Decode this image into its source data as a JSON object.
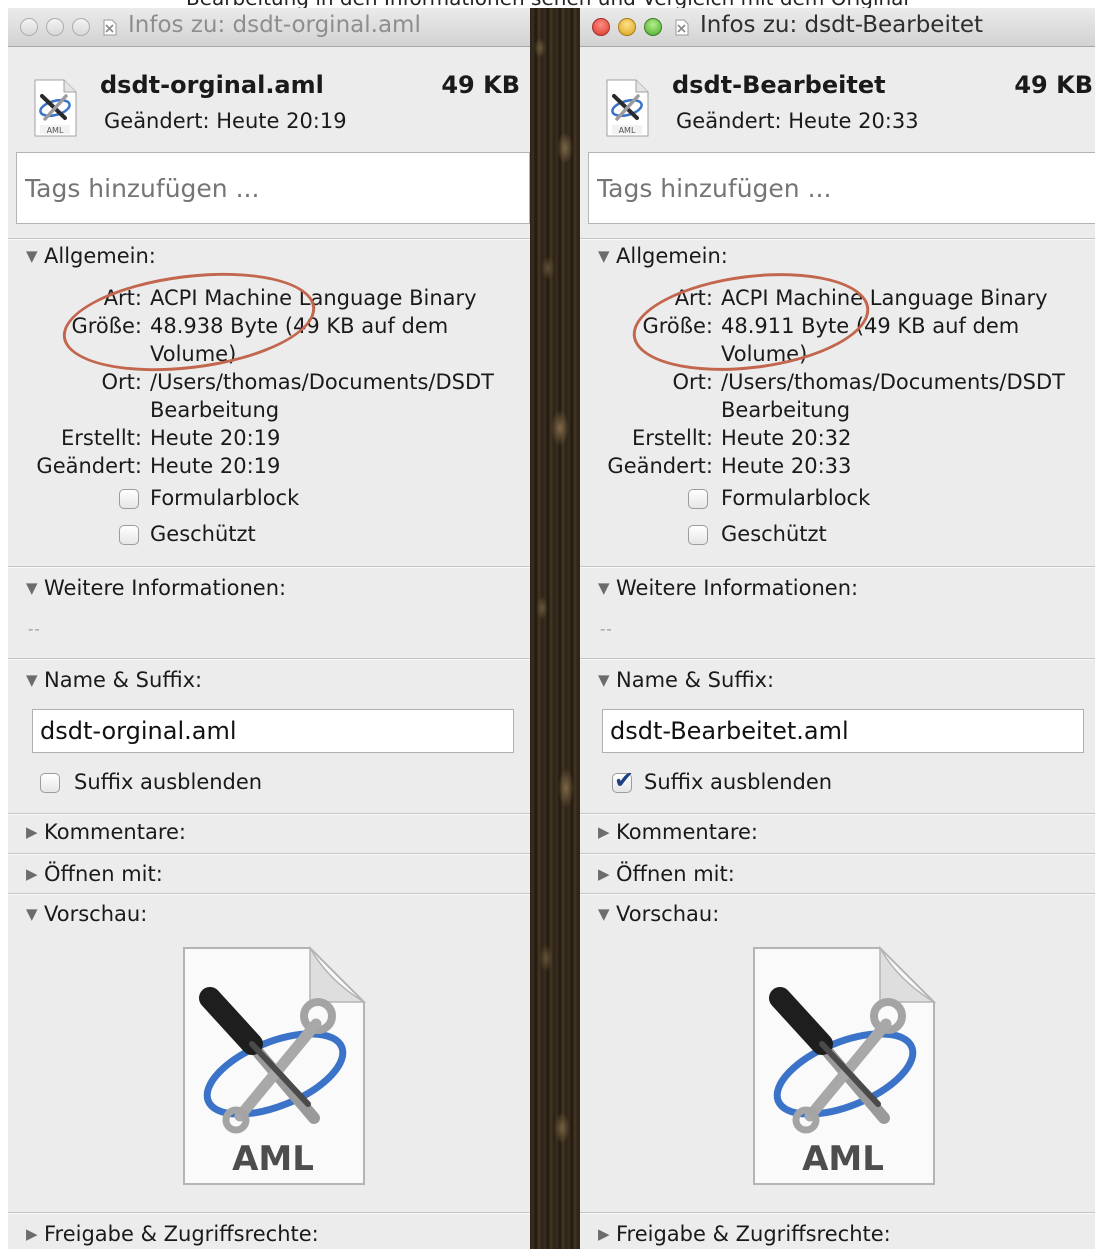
{
  "caption": "Bearbeitung in den Informationen sehen und Vergleich mit dem Original",
  "windows": [
    {
      "window_title": "Infos zu: dsdt-orginal.aml",
      "active": false,
      "file_name": "dsdt-orginal.aml",
      "file_size": "49 KB",
      "modified_line": "Geändert: Heute 20:19",
      "tags_placeholder": "Tags hinzufügen ...",
      "general": {
        "header": "Allgemein:",
        "art_label": "Art:",
        "art_value": "ACPI Machine Language Binary",
        "size_label": "Größe:",
        "size_value_line1": "48.938 Byte (49 KB auf dem",
        "size_value_line2": "Volume)",
        "location_label": "Ort:",
        "location_line1": "/Users/thomas/Documents/DSDT",
        "location_line2": "Bearbeitung",
        "created_label": "Erstellt:",
        "created_value": "Heute 20:19",
        "modified_label": "Geändert:",
        "modified_value": "Heute 20:19",
        "stationery_label": "Formularblock",
        "stationery_checked": false,
        "locked_label": "Geschützt",
        "locked_checked": false
      },
      "more_info": {
        "header": "Weitere Informationen:",
        "value": "--"
      },
      "name_extension": {
        "header": "Name & Suffix:",
        "field_value": "dsdt-orginal.aml",
        "hide_extension_label": "Suffix ausblenden",
        "hide_extension_checked": false
      },
      "comments_header": "Kommentare:",
      "open_with_header": "Öffnen mit:",
      "preview_header": "Vorschau:",
      "preview_icon_text": "AML",
      "sharing_header": "Freigabe & Zugriffsrechte:"
    },
    {
      "window_title": "Infos zu: dsdt-Bearbeitet",
      "active": true,
      "file_name": "dsdt-Bearbeitet",
      "file_size": "49 KB",
      "modified_line": "Geändert: Heute 20:33",
      "tags_placeholder": "Tags hinzufügen ...",
      "general": {
        "header": "Allgemein:",
        "art_label": "Art:",
        "art_value": "ACPI Machine Language Binary",
        "size_label": "Größe:",
        "size_value_line1": "48.911 Byte (49 KB auf dem",
        "size_value_line2": "Volume)",
        "location_label": "Ort:",
        "location_line1": "/Users/thomas/Documents/DSDT",
        "location_line2": "Bearbeitung",
        "created_label": "Erstellt:",
        "created_value": "Heute 20:32",
        "modified_label": "Geändert:",
        "modified_value": "Heute 20:33",
        "stationery_label": "Formularblock",
        "stationery_checked": false,
        "locked_label": "Geschützt",
        "locked_checked": false
      },
      "more_info": {
        "header": "Weitere Informationen:",
        "value": "--"
      },
      "name_extension": {
        "header": "Name & Suffix:",
        "field_value": "dsdt-Bearbeitet.aml",
        "hide_extension_label": "Suffix ausblenden",
        "hide_extension_checked": true
      },
      "comments_header": "Kommentare:",
      "open_with_header": "Öffnen mit:",
      "preview_header": "Vorschau:",
      "preview_icon_text": "AML",
      "sharing_header": "Freigabe & Zugriffsrechte:"
    }
  ],
  "colors": {
    "panel_background": "#ececec",
    "highlight_ring": "#c2664d",
    "checkbox_tick": "#1f3f86",
    "desk_background": "#2b2217"
  },
  "icons": {
    "small_file_icon": "aml-document-icon",
    "preview_icon": "aml-tools-document-icon"
  }
}
